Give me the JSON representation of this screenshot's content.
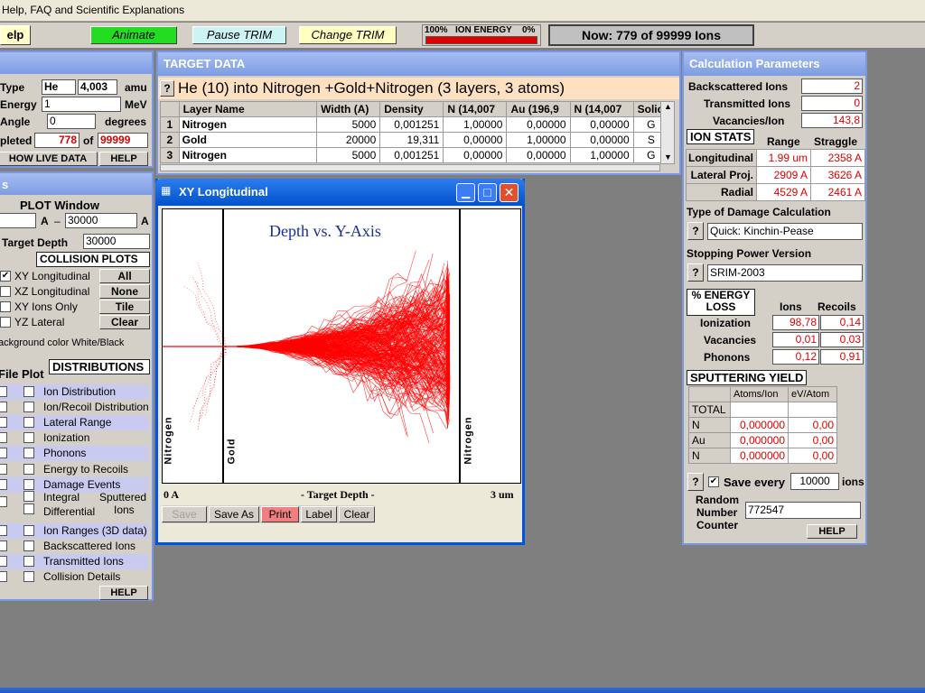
{
  "menu": {
    "text": "Help, FAQ and Scientific Explanations"
  },
  "toolbar": {
    "help": "elp",
    "animate": "Animate",
    "pause": "Pause TRIM",
    "change": "Change TRIM",
    "energy_left": "100%",
    "energy_mid": "ION ENERGY",
    "energy_right": "0%",
    "energy_fill": 1.0,
    "now": "Now: 779 of 99999 Ions"
  },
  "ion": {
    "type_label": "Type",
    "type": "He",
    "mass": "4,003",
    "amu": "amu",
    "energy_label": "Energy",
    "energy": "1",
    "mev": "MeV",
    "angle_label": "Angle",
    "angle": "0",
    "degrees": "degrees",
    "completed_label": "pleted",
    "completed": "778",
    "of": "of",
    "total": "99999",
    "show_live": "HOW LIVE DATA",
    "help": "HELP"
  },
  "plot": {
    "title_stub": "s",
    "window_label": "PLOT  Window",
    "a1": "A",
    "dash": "–",
    "to": "30000",
    "a2": "A",
    "target_depth_label": "Target Depth",
    "target_depth": "30000",
    "collision_header": "COLLISION PLOTS",
    "options": [
      {
        "label": "XY Longitudinal",
        "checked": true,
        "btn": "All"
      },
      {
        "label": "XZ Longitudinal",
        "checked": false,
        "btn": "None"
      },
      {
        "label": "XY Ions Only",
        "checked": false,
        "btn": "Tile"
      },
      {
        "label": "YZ Lateral",
        "checked": false,
        "btn": "Clear"
      }
    ],
    "bg_label": "ackground color White/Black"
  },
  "dist": {
    "file": "File",
    "plot": "Plot",
    "header": "DISTRIBUTIONS",
    "items": [
      "Ion Distribution",
      "Ion/Recoil Distribution",
      "Lateral Range",
      "Ionization",
      "Phonons",
      "Energy to Recoils",
      "Damage Events"
    ],
    "integral": "Integral",
    "differential": "Differential",
    "sputtered": "Sputtered",
    "ions": "Ions",
    "items2": [
      "Ion Ranges (3D data)",
      "Backscattered Ions",
      "Transmitted Ions",
      "Collision Details"
    ],
    "help": "HELP"
  },
  "target": {
    "title": "TARGET DATA",
    "q": "?",
    "headline": "He (10) into Nitrogen +Gold+Nitrogen (3 layers, 3 atoms)",
    "columns": [
      "Layer Name",
      "Width (A)",
      "Density",
      "N (14,007",
      "Au (196,9",
      "N (14,007",
      "Solic"
    ],
    "rows": [
      {
        "idx": "1",
        "name": "Nitrogen",
        "width": "5000",
        "density": "0,001251",
        "n1": "1,00000",
        "au": "0,00000",
        "n2": "0,00000",
        "s": "G"
      },
      {
        "idx": "2",
        "name": "Gold",
        "width": "20000",
        "density": "19,311",
        "n1": "0,00000",
        "au": "1,00000",
        "n2": "0,00000",
        "s": "S"
      },
      {
        "idx": "3",
        "name": "Nitrogen",
        "width": "5000",
        "density": "0,001251",
        "n1": "0,00000",
        "au": "0,00000",
        "n2": "1,00000",
        "s": "G"
      }
    ]
  },
  "xy": {
    "title": "XY Longitudinal",
    "plot_title": "Depth vs. Y-Axis",
    "layer1": "Nitrogen",
    "layer2": "Gold",
    "layer3": "Nitrogen",
    "x_left": "0 A",
    "x_mid": "- Target Depth -",
    "x_right": "3 um",
    "save": "Save",
    "save_as": "Save As",
    "print": "Print",
    "label": "Label",
    "clear": "Clear",
    "beam_color": "#ff0000"
  },
  "calc": {
    "title": "Calculation Parameters",
    "backscattered_label": "Backscattered Ions",
    "backscattered": "2",
    "transmitted_label": "Transmitted Ions",
    "transmitted": "0",
    "vacancies_label": "Vacancies/Ion",
    "vacancies": "143,8",
    "ion_stats": "ION STATS",
    "range": "Range",
    "straggle": "Straggle",
    "stats": [
      {
        "k": "Longitudinal",
        "r": "1.99 um",
        "s": "2358 A"
      },
      {
        "k": "Lateral Proj.",
        "r": "2909 A",
        "s": "3626 A"
      },
      {
        "k": "Radial",
        "r": "4529 A",
        "s": "2461 A"
      }
    ],
    "damage_label": "Type of Damage Calculation",
    "damage": "Quick: Kinchin-Pease",
    "stopping_label": "Stopping Power Version",
    "stopping": "SRIM-2003",
    "q": "?",
    "energy_loss_1": "% ENERGY",
    "energy_loss_2": "LOSS",
    "ions": "Ions",
    "recoils": "Recoils",
    "loss": [
      {
        "k": "Ionization",
        "i": "98,78",
        "r": "0,14"
      },
      {
        "k": "Vacancies",
        "i": "0,01",
        "r": "0,03"
      },
      {
        "k": "Phonons",
        "i": "0,12",
        "r": "0,91"
      }
    ],
    "sputter_header": "SPUTTERING YIELD",
    "atoms_ion": "Atoms/Ion",
    "ev_atom": "eV/Atom",
    "sputter": [
      {
        "k": "TOTAL",
        "a": "",
        "e": ""
      },
      {
        "k": "N",
        "a": "0,000000",
        "e": "0,00"
      },
      {
        "k": "Au",
        "a": "0,000000",
        "e": "0,00"
      },
      {
        "k": "N",
        "a": "0,000000",
        "e": "0,00"
      }
    ],
    "save_every_label": "Save every",
    "save_every": "10000",
    "ions_unit": "ions",
    "random_1": "Random",
    "random_2": "Number",
    "random_3": "Counter",
    "random": "772547",
    "help": "HELP"
  }
}
